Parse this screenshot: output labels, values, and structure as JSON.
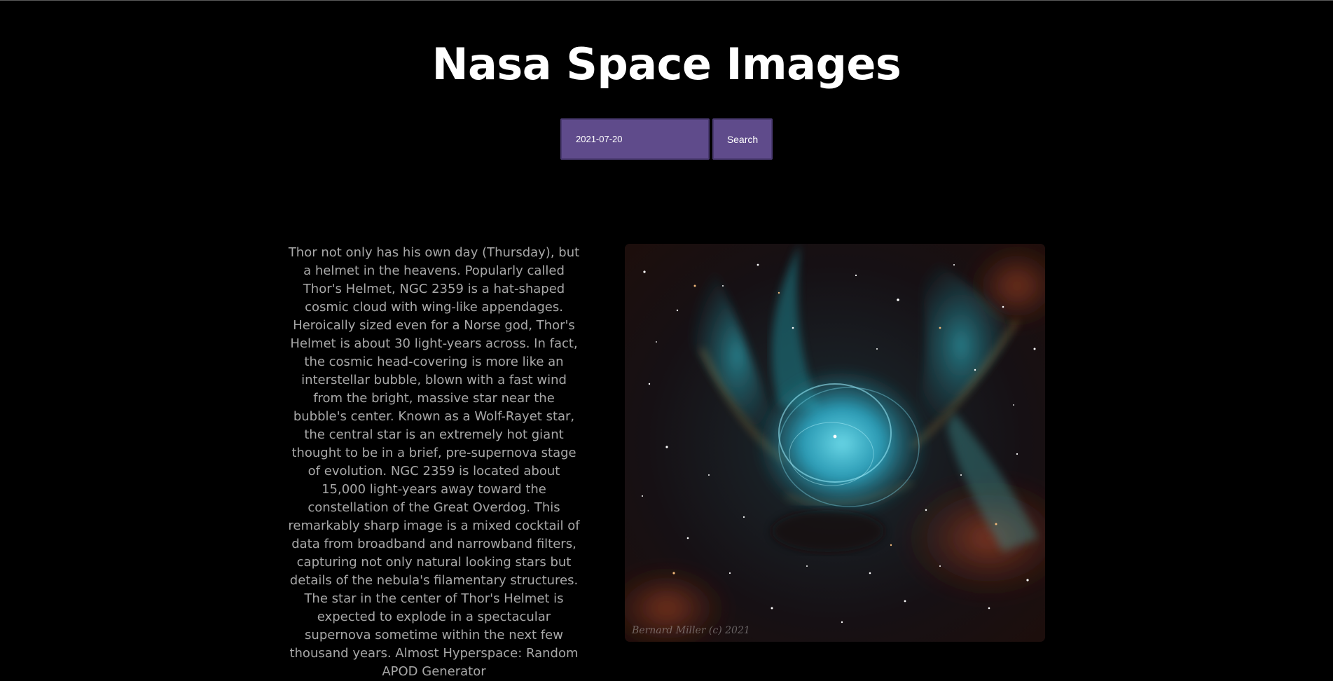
{
  "header": {
    "title": "Nasa Space Images"
  },
  "search": {
    "date_value": "2021-07-20",
    "button_label": "Search"
  },
  "apod": {
    "explanation": "Thor not only has his own day (Thursday), but a helmet in the heavens.  Popularly called Thor's Helmet, NGC 2359 is a hat-shaped cosmic cloud with wing-like appendages. Heroically sized even for a Norse god, Thor's Helmet is about 30 light-years across. In fact, the cosmic head-covering is more like an interstellar bubble, blown with a fast wind from the bright, massive star near the bubble's center. Known as a Wolf-Rayet star, the central star is an extremely hot giant thought to be in a brief, pre-supernova stage of evolution. NGC 2359 is located about 15,000 light-years away toward the constellation of the Great Overdog. This remarkably sharp image is a mixed cocktail of data from broadband and narrowband filters, capturing not only natural looking stars but details of the nebula's filamentary structures. The star in the center of Thor's Helmet is expected to explode in a spectacular supernova sometime within the next few thousand years. Almost Hyperspace: Random APOD Generator",
    "image_credit": "Bernard Miller (c) 2021",
    "colors": {
      "nebula_core": "#2fb7d6",
      "nebula_outer": "#1f6f7a",
      "dust": "#b04a2a",
      "background": "#140c0c"
    }
  },
  "colors": {
    "page_background": "#000000",
    "accent": "#5f4b8b",
    "text_muted": "#a8a8a8"
  }
}
